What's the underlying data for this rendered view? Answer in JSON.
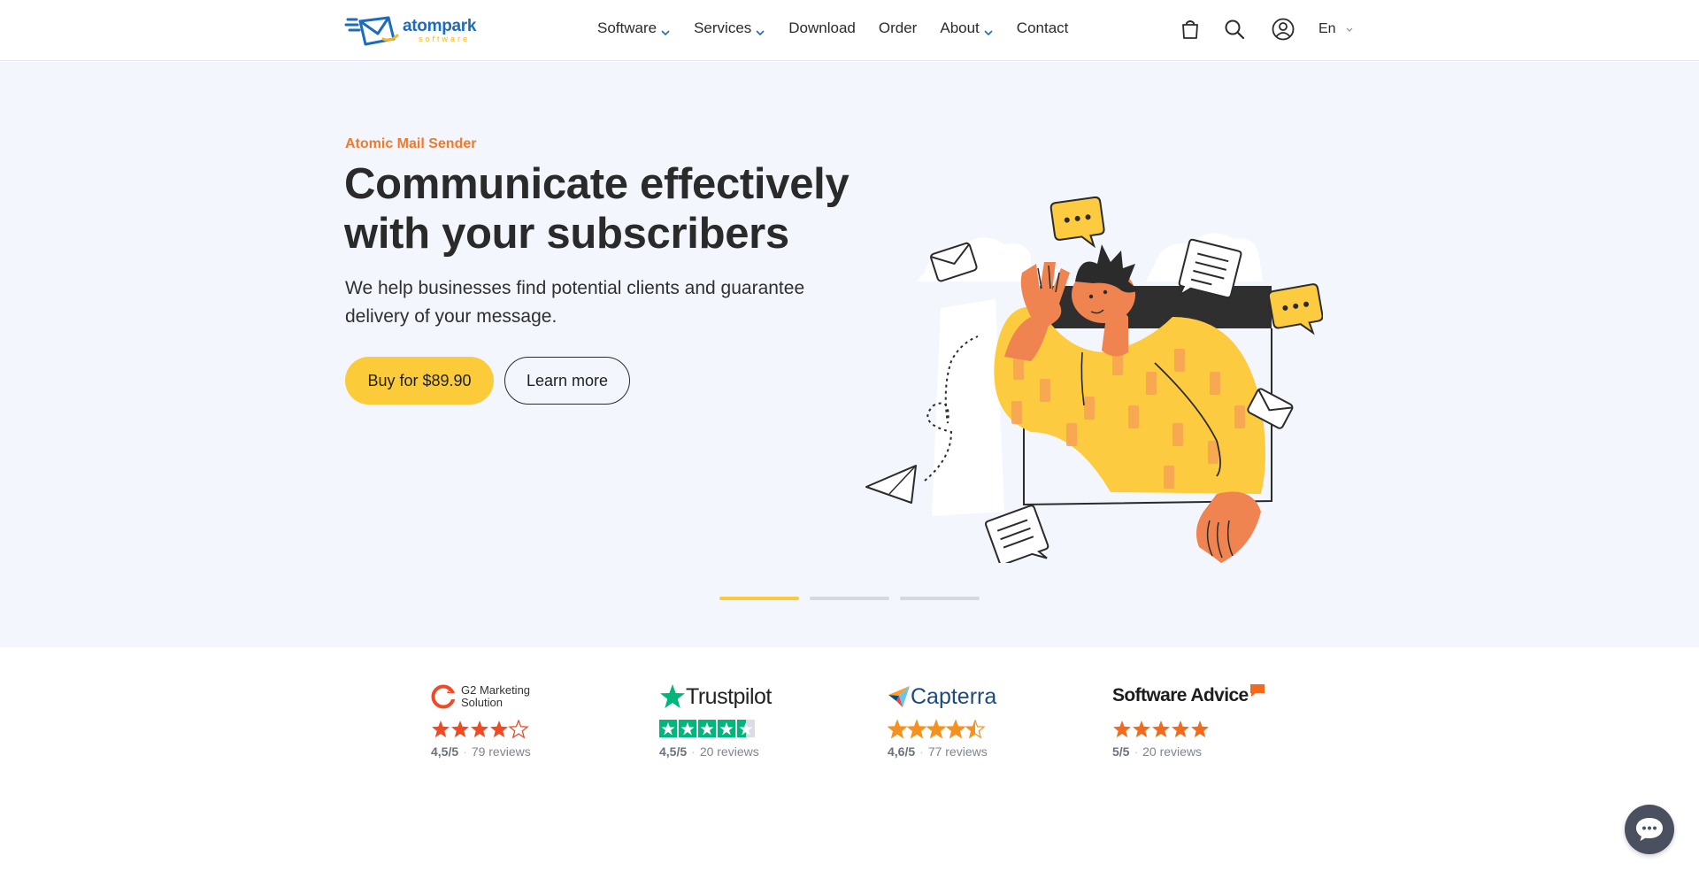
{
  "header": {
    "logo": {
      "name": "atompark",
      "tagline": "software"
    },
    "nav": [
      {
        "label": "Software",
        "has_dropdown": true
      },
      {
        "label": "Services",
        "has_dropdown": true
      },
      {
        "label": "Download",
        "has_dropdown": false
      },
      {
        "label": "Order",
        "has_dropdown": false
      },
      {
        "label": "About",
        "has_dropdown": true
      },
      {
        "label": "Contact",
        "has_dropdown": false
      }
    ],
    "icons": [
      "cart-icon",
      "search-icon",
      "account-icon"
    ],
    "language": "En"
  },
  "hero": {
    "eyebrow": "Atomic Mail Sender",
    "title": "Communicate effectively with your subscribers",
    "subtitle": "We help businesses find potential clients and guarantee delivery of your message.",
    "buy_label": "Buy for $89.90",
    "learn_label": "Learn more",
    "slides": {
      "count": 3,
      "active": 1
    }
  },
  "reviews": [
    {
      "brand": "G2",
      "label": "G2 Marketing Solution",
      "score": "4,5/5",
      "count": "79 reviews",
      "rating": 4
    },
    {
      "brand": "Trustpilot",
      "label": "Trustpilot",
      "score": "4,5/5",
      "count": "20 reviews",
      "rating": 4.5
    },
    {
      "brand": "Capterra",
      "label": "Capterra",
      "score": "4,6/5",
      "count": "77 reviews",
      "rating": 4.5
    },
    {
      "brand": "Software Advice",
      "label": "Software Advice",
      "score": "5/5",
      "count": "20 reviews",
      "rating": 5
    }
  ],
  "colors": {
    "accent_yellow": "#fccb3a",
    "accent_orange": "#ee7a2d",
    "brand_blue": "#1c6bbd",
    "hero_bg": "#f3f6fc",
    "trustpilot_green": "#00b67a",
    "capterra_blue": "#1c4a7e",
    "star_orange": "#f26b3a"
  },
  "chat": {
    "icon": "chat-icon"
  }
}
